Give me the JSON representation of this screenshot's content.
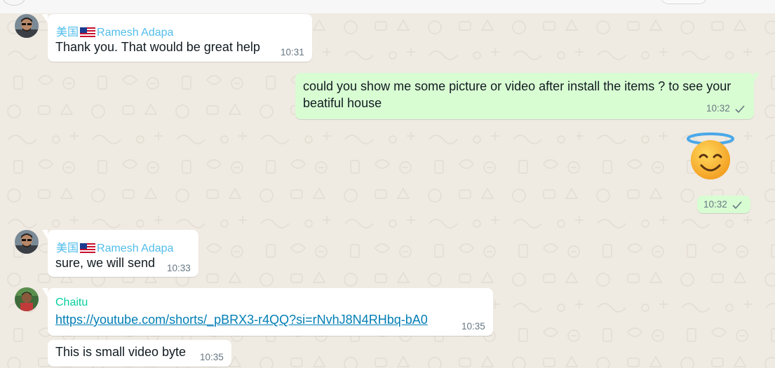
{
  "messages": [
    {
      "sender_prefix": "美国",
      "sender_name": "Ramesh Adapa",
      "text": "Thank you. That would be great help",
      "time": "10:31"
    },
    {
      "text": "could you show me some picture or video after install the items ? to see your beatiful house",
      "time": "10:32"
    },
    {
      "emoji": "smiling-face-with-halo",
      "time": "10:32"
    },
    {
      "sender_prefix": "美国",
      "sender_name": "Ramesh Adapa",
      "text": "sure, we will send",
      "time": "10:33"
    },
    {
      "sender_name": "Chaitu",
      "link": "https://youtube.com/shorts/_pBRX3-r4QQ?si=rNvhJ8N4RHbq-bA0",
      "time": "10:35"
    },
    {
      "text": "This is small video byte",
      "time": "10:35"
    }
  ],
  "colors": {
    "chat_bg": "#efeae2",
    "incoming_bubble": "#ffffff",
    "outgoing_bubble": "#d9fdd3",
    "sender_ramesh": "#53bdeb",
    "sender_chaitu": "#06cf9c",
    "link": "#027eb5"
  },
  "icons": [
    "avatar-ramesh",
    "avatar-chaitu",
    "us-flag-icon",
    "single-check-icon"
  ]
}
